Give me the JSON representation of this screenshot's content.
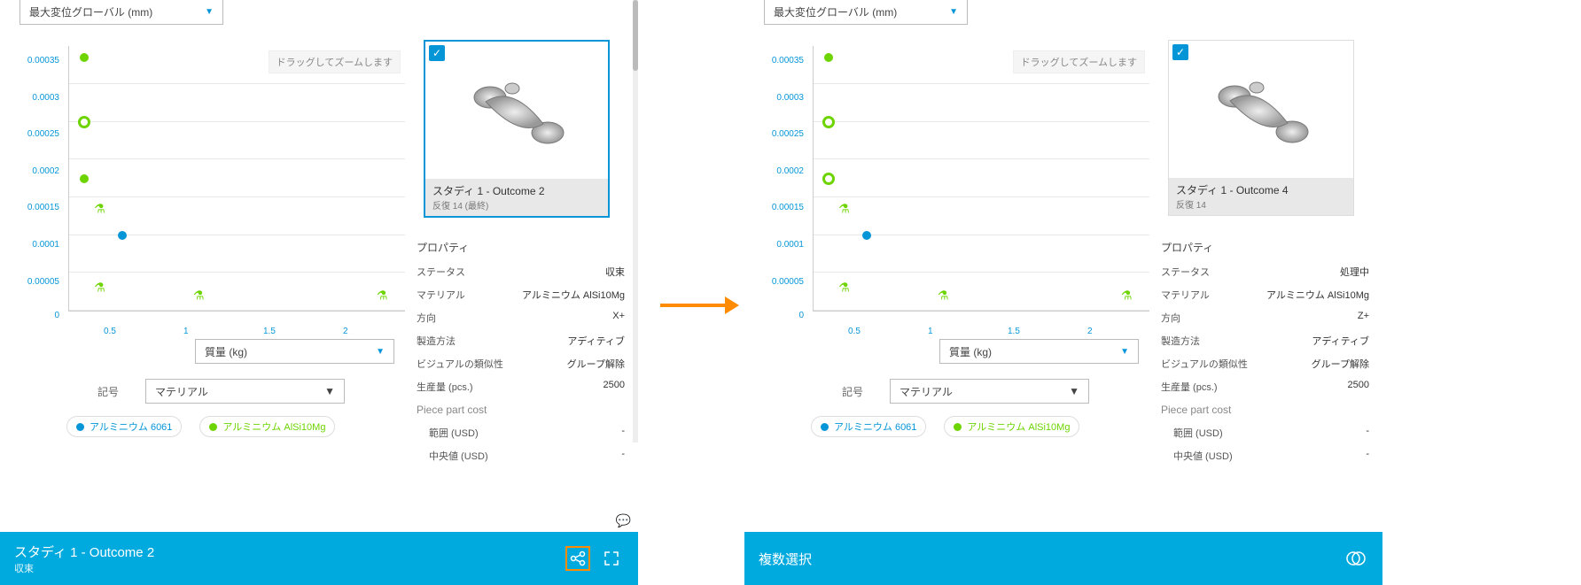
{
  "arrow_color": "#ff8c00",
  "left": {
    "y_axis": "最大変位グローバル (mm)",
    "x_axis": "質量 (kg)",
    "zoom_hint": "ドラッグしてズームします",
    "symbol_label": "記号",
    "symbol_dropdown": "マテリアル",
    "legend": [
      {
        "label": "アルミニウム 6061",
        "color": "#0696d7"
      },
      {
        "label": "アルミニウム AlSi10Mg",
        "color": "#6dd400"
      }
    ],
    "chart_data": {
      "type": "scatter",
      "xlabel": "質量 (kg)",
      "ylabel": "最大変位グローバル (mm)",
      "x_ticks": [
        0.5,
        1,
        1.5,
        2
      ],
      "y_ticks": [
        0,
        5e-05,
        0.0001,
        0.00015,
        0.0002,
        0.00025,
        0.0003,
        0.00035
      ],
      "xlim": [
        0.2,
        2.4
      ],
      "ylim": [
        0,
        0.00035
      ],
      "series": [
        {
          "name": "アルミニウム 6061",
          "color": "#0696d7",
          "marker": "dot",
          "points": [
            {
              "x": 0.55,
              "y": 0.0001
            }
          ]
        },
        {
          "name": "アルミニウム AlSi10Mg",
          "color": "#6dd400",
          "marker": "dot",
          "points": [
            {
              "x": 0.3,
              "y": 0.000335
            },
            {
              "x": 0.3,
              "y": 0.000175
            }
          ]
        },
        {
          "name": "アルミニウム AlSi10Mg (selected)",
          "color": "#6dd400",
          "marker": "ring",
          "points": [
            {
              "x": 0.3,
              "y": 0.00025
            }
          ]
        },
        {
          "name": "アルミニウム AlSi10Mg (processing)",
          "color": "#6dd400",
          "marker": "flask",
          "points": [
            {
              "x": 0.4,
              "y": 0.000135
            },
            {
              "x": 0.4,
              "y": 3e-05
            },
            {
              "x": 1.05,
              "y": 2e-05
            },
            {
              "x": 2.25,
              "y": 2e-05
            }
          ]
        }
      ]
    },
    "thumb": {
      "title": "スタディ 1 - Outcome 2",
      "sub": "反復 14 (最終)",
      "selected": true
    },
    "props_header": "プロパティ",
    "props": [
      {
        "k": "ステータス",
        "v": "収束"
      },
      {
        "k": "マテリアル",
        "v": "アルミニウム AlSi10Mg"
      },
      {
        "k": "方向",
        "v": "X+"
      },
      {
        "k": "製造方法",
        "v": "アディティブ"
      },
      {
        "k": "ビジュアルの類似性",
        "v": "グループ解除"
      },
      {
        "k": "生産量 (pcs.)",
        "v": "2500"
      }
    ],
    "cost_header": "Piece part cost",
    "cost": [
      {
        "k": "範囲 (USD)",
        "v": "-"
      },
      {
        "k": "中央値 (USD)",
        "v": "-"
      }
    ],
    "footer": {
      "title": "スタディ 1 - Outcome 2",
      "sub": "収束"
    }
  },
  "right": {
    "y_axis": "最大変位グローバル (mm)",
    "x_axis": "質量 (kg)",
    "zoom_hint": "ドラッグしてズームします",
    "symbol_label": "記号",
    "symbol_dropdown": "マテリアル",
    "legend": [
      {
        "label": "アルミニウム 6061",
        "color": "#0696d7"
      },
      {
        "label": "アルミニウム AlSi10Mg",
        "color": "#6dd400"
      }
    ],
    "chart_data": {
      "type": "scatter",
      "xlabel": "質量 (kg)",
      "ylabel": "最大変位グローバル (mm)",
      "x_ticks": [
        0.5,
        1,
        1.5,
        2
      ],
      "y_ticks": [
        0,
        5e-05,
        0.0001,
        0.00015,
        0.0002,
        0.00025,
        0.0003,
        0.00035
      ],
      "xlim": [
        0.2,
        2.4
      ],
      "ylim": [
        0,
        0.00035
      ],
      "series": [
        {
          "name": "アルミニウム 6061",
          "color": "#0696d7",
          "marker": "dot",
          "points": [
            {
              "x": 0.55,
              "y": 0.0001
            }
          ]
        },
        {
          "name": "アルミニウム AlSi10Mg",
          "color": "#6dd400",
          "marker": "dot",
          "points": [
            {
              "x": 0.3,
              "y": 0.000335
            }
          ]
        },
        {
          "name": "アルミニウム AlSi10Mg (selected)",
          "color": "#6dd400",
          "marker": "ring",
          "points": [
            {
              "x": 0.3,
              "y": 0.00025
            },
            {
              "x": 0.3,
              "y": 0.000175
            }
          ]
        },
        {
          "name": "アルミニウム AlSi10Mg (processing)",
          "color": "#6dd400",
          "marker": "flask",
          "points": [
            {
              "x": 0.4,
              "y": 0.000135
            },
            {
              "x": 0.4,
              "y": 3e-05
            },
            {
              "x": 1.05,
              "y": 2e-05
            },
            {
              "x": 2.25,
              "y": 2e-05
            }
          ]
        }
      ]
    },
    "thumb": {
      "title": "スタディ 1 - Outcome 4",
      "sub": "反復 14",
      "selected": true
    },
    "props_header": "プロパティ",
    "props": [
      {
        "k": "ステータス",
        "v": "処理中"
      },
      {
        "k": "マテリアル",
        "v": "アルミニウム AlSi10Mg"
      },
      {
        "k": "方向",
        "v": "Z+"
      },
      {
        "k": "製造方法",
        "v": "アディティブ"
      },
      {
        "k": "ビジュアルの類似性",
        "v": "グループ解除"
      },
      {
        "k": "生産量 (pcs.)",
        "v": "2500"
      }
    ],
    "cost_header": "Piece part cost",
    "cost": [
      {
        "k": "範囲 (USD)",
        "v": "-"
      },
      {
        "k": "中央値 (USD)",
        "v": "-"
      }
    ],
    "footer": {
      "title": "複数選択",
      "sub": ""
    }
  }
}
